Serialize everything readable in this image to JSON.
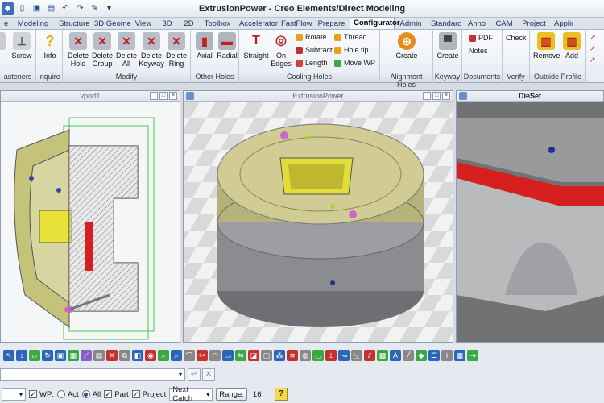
{
  "window": {
    "title": "ExtrusionPower - Creo Elements/Direct Modeling"
  },
  "tabs": [
    "e",
    "Modeling",
    "Structure",
    "3D Geome",
    "View",
    "3D",
    "2D",
    "Toolbox",
    "Accelerator",
    "FastFlow",
    "Prepare",
    "Configurator",
    "Admin",
    "Standard",
    "Anno",
    "CAM",
    "Project",
    "Applic"
  ],
  "active_tab": "Configurator",
  "ribbon": {
    "fasteners": {
      "label": "asteners",
      "screw": "Screw"
    },
    "inquire": {
      "label": "Inquire",
      "info": "Info"
    },
    "modify": {
      "label": "Modify",
      "b1": "Delete",
      "b1b": "Hole",
      "b2": "Delete",
      "b2b": "Group",
      "b3": "Delete",
      "b3b": "All",
      "b4": "Delete",
      "b4b": "Keyway",
      "b5": "Delete",
      "b5b": "Ring"
    },
    "other_holes": {
      "label": "Other Holes",
      "axial": "Axial",
      "radial": "Radial"
    },
    "cooling": {
      "label": "Cooling Holes",
      "straight": "Straight",
      "on_edges_a": "On",
      "on_edges_b": "Edges",
      "rotate": "Rotate",
      "subtract": "Subtract",
      "length": "Length",
      "thread": "Thread",
      "hole_tip": "Hole tip",
      "move_wp": "Move WP"
    },
    "alignment": {
      "label": "Alignment Holes",
      "create": "Create"
    },
    "keyway": {
      "label": "Keyway",
      "create": "Create"
    },
    "documents": {
      "label": "Documents",
      "pdf": "PDF",
      "notes": "Notes"
    },
    "verify": {
      "label": "Verify",
      "check": "Check"
    },
    "outside": {
      "label": "Outside Profile",
      "remove": "Remove",
      "add": "Add"
    }
  },
  "viewports": {
    "left": "vport1",
    "middle": "ExtrusionPower",
    "right": "DieSet"
  },
  "status": {
    "wp_label": "WP:",
    "act": "Act",
    "all": "All",
    "part": "Part",
    "project": "Project",
    "next_catch": "Next Catch",
    "range": "Range:",
    "range_value": "16",
    "help": "?"
  },
  "colors": {
    "accent": "#1b4e9b",
    "part_gold": "#c9c78a",
    "part_gray": "#8a8c90",
    "highlight_red": "#e02020"
  }
}
